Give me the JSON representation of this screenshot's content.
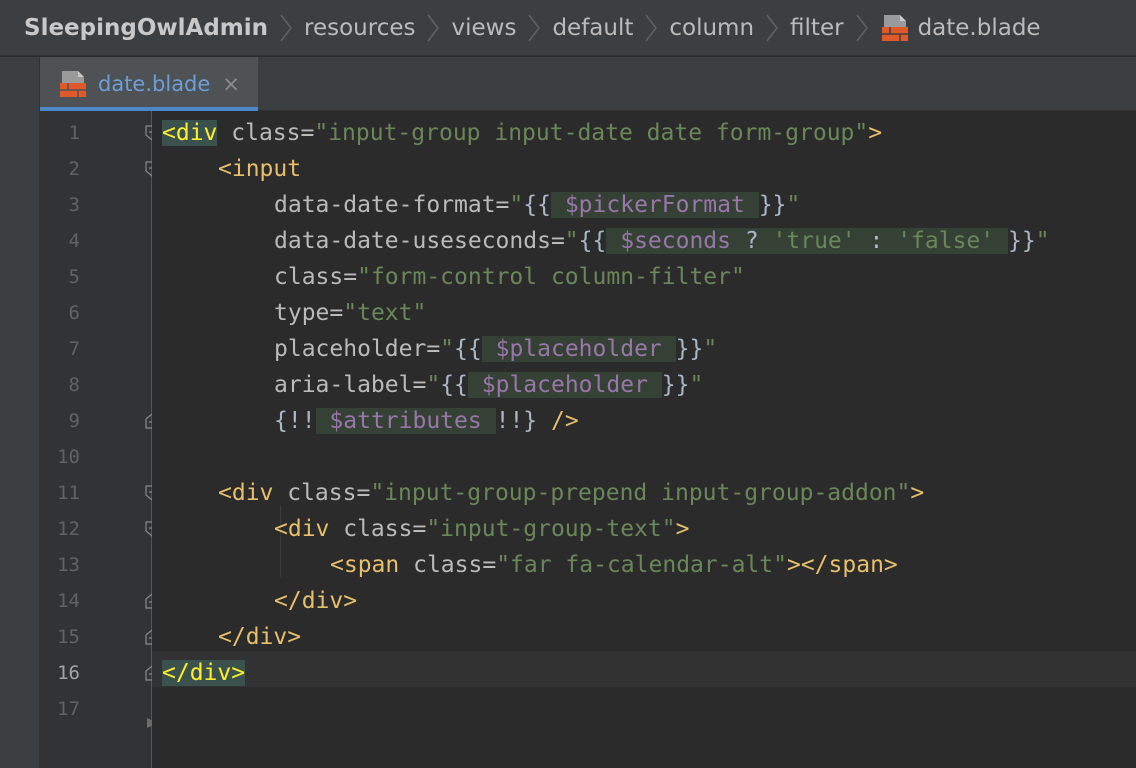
{
  "breadcrumb": {
    "root": "SleepingOwlAdmin",
    "items": [
      "resources",
      "views",
      "default",
      "column",
      "filter"
    ],
    "file": "date.blade",
    "file_icon": "blade-file-icon"
  },
  "tab": {
    "label": "date.blade",
    "close": "×",
    "icon": "blade-file-icon"
  },
  "gutter": {
    "line_numbers": [
      "1",
      "2",
      "3",
      "4",
      "5",
      "6",
      "7",
      "8",
      "9",
      "10",
      "11",
      "12",
      "13",
      "14",
      "15",
      "16",
      "17"
    ],
    "current_line": "16"
  },
  "code": {
    "l1": {
      "lt": "<",
      "tag": "div",
      "attr": " class=",
      "val": "\"input-group input-date date form-group\"",
      "gt": ">"
    },
    "l2": {
      "tag": "<input"
    },
    "l3": {
      "attr": "data-date-format=",
      "q1": "\"",
      "o": "{{",
      "sp1": " ",
      "var": "$pickerFormat",
      "sp2": " ",
      "c": "}}",
      "q2": "\""
    },
    "l4": {
      "attr": "data-date-useseconds=",
      "q1": "\"",
      "o": "{{",
      "sp1": " ",
      "var": "$seconds",
      "op1": " ? ",
      "s1": "'true'",
      "op2": " : ",
      "s2": "'false'",
      "sp2": " ",
      "c": "}}",
      "q2": "\""
    },
    "l5": {
      "attr": "class=",
      "val": "\"form-control column-filter\""
    },
    "l6": {
      "attr": "type=",
      "val": "\"text\""
    },
    "l7": {
      "attr": "placeholder=",
      "q1": "\"",
      "o": "{{",
      "sp1": " ",
      "var": "$placeholder",
      "sp2": " ",
      "c": "}}",
      "q2": "\""
    },
    "l8": {
      "attr": "aria-label=",
      "q1": "\"",
      "o": "{{",
      "sp1": " ",
      "var": "$placeholder",
      "sp2": " ",
      "c": "}}",
      "q2": "\""
    },
    "l9": {
      "o": "{!!",
      "sp1": " ",
      "var": "$attributes",
      "sp2": " ",
      "c": "!!}",
      "end": " />"
    },
    "l11": {
      "tag": "<div",
      "attr": " class=",
      "val": "\"input-group-prepend input-group-addon\"",
      "gt": ">"
    },
    "l12": {
      "tag": "<div",
      "attr": " class=",
      "val": "\"input-group-text\"",
      "gt": ">"
    },
    "l13": {
      "tag": "<span",
      "attr": " class=",
      "val": "\"far fa-calendar-alt\"",
      "gt": "></span>"
    },
    "l14": {
      "tag": "</div>"
    },
    "l15": {
      "tag": "</div>"
    },
    "l16": {
      "lt": "</",
      "tag": "div",
      "gt": ">"
    }
  },
  "colors": {
    "tag": "#e8bf6a",
    "attribute": "#bababa",
    "string": "#6a8759",
    "variable": "#9876aa",
    "accent": "#4a88c7"
  }
}
